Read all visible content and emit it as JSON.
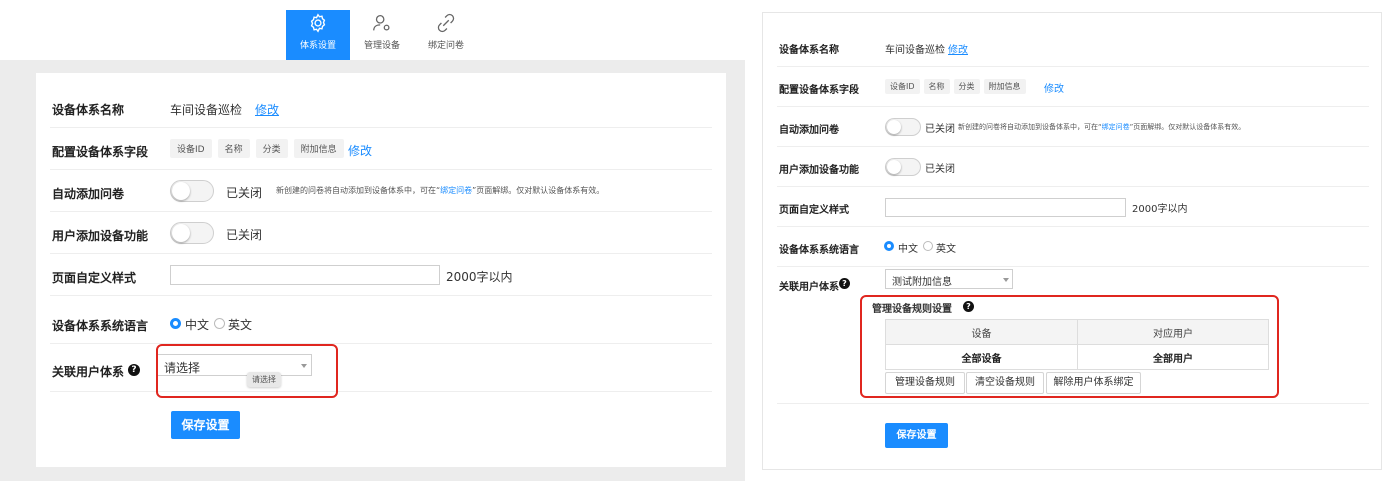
{
  "left": {
    "nav": [
      {
        "label": "体系设置",
        "icon": "gear-icon"
      },
      {
        "label": "管理设备",
        "icon": "user-settings-icon"
      },
      {
        "label": "绑定问卷",
        "icon": "link-icon"
      }
    ],
    "system_name": {
      "label": "设备体系名称",
      "value": "车间设备巡检",
      "edit": "修改"
    },
    "fields": {
      "label": "配置设备体系字段",
      "tags": [
        "设备ID",
        "名称",
        "分类",
        "附加信息"
      ],
      "edit": "修改"
    },
    "auto_add": {
      "label": "自动添加问卷",
      "state": "已关闭",
      "desc_prefix": "新创建的问卷将自动添加到设备体系中，可在“",
      "desc_link": "绑定问卷",
      "desc_suffix": "”页面解绑。仅对默认设备体系有效。"
    },
    "user_add": {
      "label": "用户添加设备功能",
      "state": "已关闭"
    },
    "custom_style": {
      "label": "页面自定义样式",
      "hint": "2000字以内"
    },
    "language": {
      "label": "设备体系系统语言",
      "options": [
        "中文",
        "英文"
      ]
    },
    "related_user": {
      "label": "关联用户体系",
      "placeholder": "请选择",
      "tooltip": "请选择"
    },
    "save": "保存设置"
  },
  "right": {
    "system_name": {
      "label": "设备体系名称",
      "value": "车间设备巡检",
      "edit": "修改"
    },
    "fields": {
      "label": "配置设备体系字段",
      "tags": [
        "设备ID",
        "名称",
        "分类",
        "附加信息"
      ],
      "edit": "修改"
    },
    "auto_add": {
      "label": "自动添加问卷",
      "state": "已关闭",
      "desc_prefix": "新创建的问卷将自动添加到设备体系中，可在“",
      "desc_link": "绑定问卷",
      "desc_suffix": "”页面解绑。仅对默认设备体系有效。"
    },
    "user_add": {
      "label": "用户添加设备功能",
      "state": "已关闭"
    },
    "custom_style": {
      "label": "页面自定义样式",
      "hint": "2000字以内"
    },
    "language": {
      "label": "设备体系系统语言",
      "options": [
        "中文",
        "英文"
      ]
    },
    "related_user": {
      "label": "关联用户体系",
      "selected": "测试附加信息"
    },
    "rules": {
      "title": "管理设备规则设置",
      "headers": [
        "设备",
        "对应用户"
      ],
      "row": [
        "全部设备",
        "全部用户"
      ],
      "buttons": [
        "管理设备规则",
        "清空设备规则",
        "解除用户体系绑定"
      ]
    },
    "save": "保存设置"
  },
  "colors": {
    "accent": "#1a8cff",
    "highlight": "#e0261f"
  }
}
